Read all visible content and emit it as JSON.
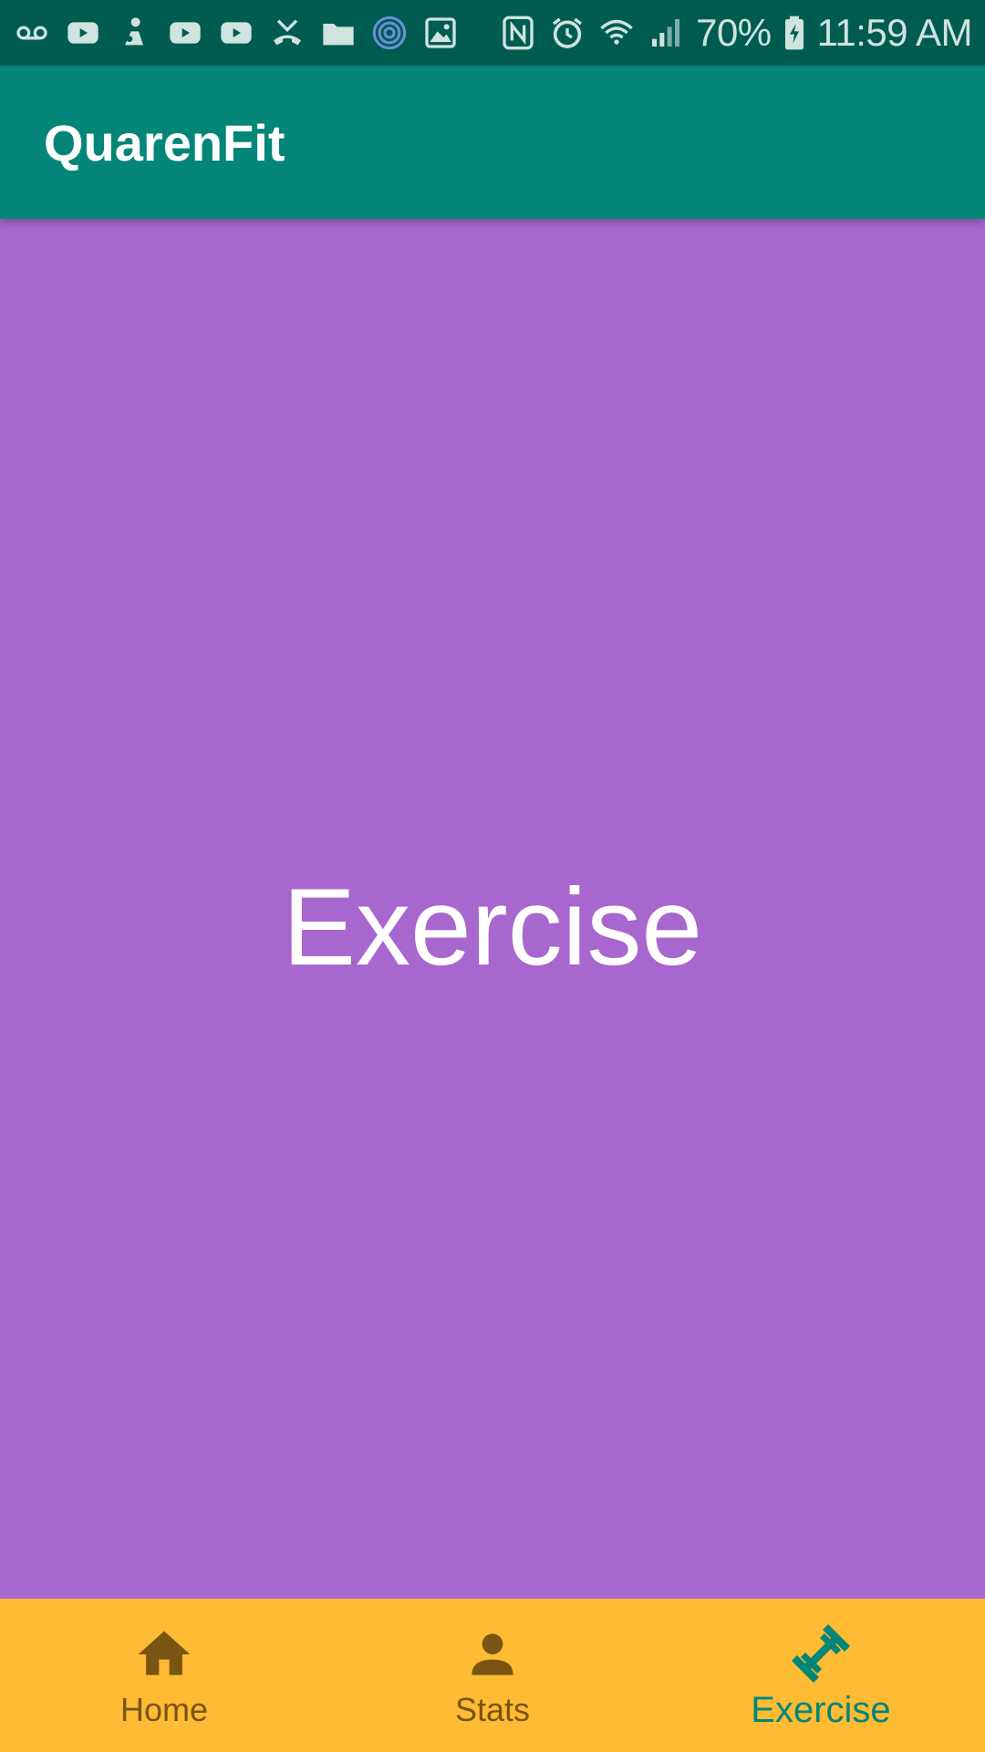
{
  "status_bar": {
    "battery_percent": "70%",
    "time": "11:59 AM",
    "left_icons": [
      "voicemail-icon",
      "youtube-icon",
      "app-notification-icon",
      "youtube-icon",
      "youtube-icon",
      "missed-call-icon",
      "folder-icon",
      "fingerprint-icon",
      "image-icon"
    ],
    "right_icons": [
      "nfc-icon",
      "alarm-icon",
      "wifi-icon",
      "signal-icon",
      "battery-charging-icon"
    ]
  },
  "app_bar": {
    "title": "QuarenFit",
    "color": "#038678"
  },
  "content": {
    "label": "Exercise",
    "background": "#a866cf"
  },
  "bottom_nav": {
    "background": "#ffbb33",
    "active_color": "#038678",
    "inactive_color": "#7a5412",
    "items": [
      {
        "label": "Home",
        "icon": "home-icon",
        "active": false
      },
      {
        "label": "Stats",
        "icon": "person-icon",
        "active": false
      },
      {
        "label": "Exercise",
        "icon": "dumbbell-icon",
        "active": true
      }
    ]
  }
}
